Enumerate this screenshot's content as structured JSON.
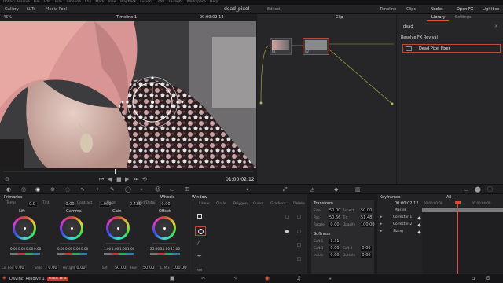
{
  "app": {
    "menu": [
      "DaVinci Resolve",
      "File",
      "Edit",
      "Trim",
      "Timeline",
      "Clip",
      "Mark",
      "View",
      "Playback",
      "Fusion",
      "Color",
      "Fairlight",
      "Workspace",
      "Help"
    ],
    "project": "dead_pixel",
    "project_status": "Edited",
    "top_tools": [
      "Gallery",
      "LUTs",
      "Media Pool"
    ],
    "right_tools": [
      "Timeline",
      "Clips",
      "Nodes",
      "Open FX",
      "Lightbox"
    ],
    "zoom": "45%",
    "timeline_name": "Timeline 1",
    "timecode_top": "00:00:02:12",
    "clip_mode": "Clip"
  },
  "viewer": {
    "timecode": "01:00:02:12"
  },
  "nodes": {
    "node1": "01",
    "node2": "02"
  },
  "library": {
    "tabs": [
      "Library",
      "Settings"
    ],
    "search": "dead",
    "group": "Resolve FX Revival",
    "item": "Dead Pixel Fixer"
  },
  "primaries": {
    "title": "Primaries",
    "wheels_label": "Wheels",
    "params": [
      {
        "label": "Temp",
        "value": "0.0"
      },
      {
        "label": "Tint",
        "value": "0.00"
      },
      {
        "label": "Contrast",
        "value": "1.000"
      },
      {
        "label": "Pivot",
        "value": "0.435"
      },
      {
        "label": "Mid/Detail",
        "value": "0.00"
      }
    ],
    "wheels": [
      {
        "name": "Lift",
        "vals": [
          "0.00",
          "0.00",
          "0.00",
          "0.00"
        ],
        "c": "#cfcfd1"
      },
      {
        "name": "Gamma",
        "vals": [
          "0.00",
          "0.00",
          "0.00",
          "0.00"
        ],
        "c": "#cfcfd1"
      },
      {
        "name": "Gain",
        "vals": [
          "1.00",
          "1.00",
          "1.00",
          "1.00"
        ],
        "c": "#cfcfd1"
      },
      {
        "name": "Offset",
        "vals": [
          "25.00",
          "25.00",
          "25.00"
        ],
        "c": "#cfcfd1"
      }
    ],
    "bottom": [
      {
        "label": "Col Boost",
        "value": "0.00"
      },
      {
        "label": "Shad",
        "value": "0.00"
      },
      {
        "label": "Hi/Light",
        "value": "0.00"
      },
      {
        "label": "Sat",
        "value": "50.00"
      },
      {
        "label": "Hue",
        "value": "50.00"
      },
      {
        "label": "L. Mix",
        "value": "100.00"
      }
    ]
  },
  "window": {
    "title": "Window",
    "tools": [
      "Linear",
      "Circle",
      "Polygon",
      "Curve",
      "Gradient"
    ],
    "delete": "Delete"
  },
  "transform": {
    "title": "Transform",
    "rows": [
      {
        "l1": "Size",
        "v1": "50.00",
        "l2": "Aspect",
        "v2": "50.00"
      },
      {
        "l1": "Pan",
        "v1": "50.66",
        "l2": "Tilt",
        "v2": "51.48"
      },
      {
        "l1": "Rotate",
        "v1": "0.00",
        "l2": "Opacity",
        "v2": "100.00"
      }
    ],
    "softness_title": "Softness",
    "soft": [
      {
        "l1": "Soft 1",
        "v1": "1.31",
        "l2": "",
        "v2": ""
      },
      {
        "l1": "Soft 3",
        "v1": "0.00",
        "l2": "Soft 4",
        "v2": "0.00"
      },
      {
        "l1": "Inside",
        "v1": "0.00",
        "l2": "Outside",
        "v2": "0.00"
      }
    ]
  },
  "keyframes": {
    "title": "Keyframes",
    "mode": "All",
    "timecode": "00:00:02:12",
    "start": "00:00:00:00",
    "end": "00:00:04:00",
    "tracks": [
      "Master",
      "Corrector 1",
      "Corrector 2",
      "Sizing"
    ]
  },
  "footer": {
    "product": "DaVinci Resolve 17",
    "badge": "PUBLIC BETA"
  },
  "colors": {
    "accent": "#e2543a",
    "playhead": "#e0493a",
    "bg": "#1b1b1d"
  }
}
